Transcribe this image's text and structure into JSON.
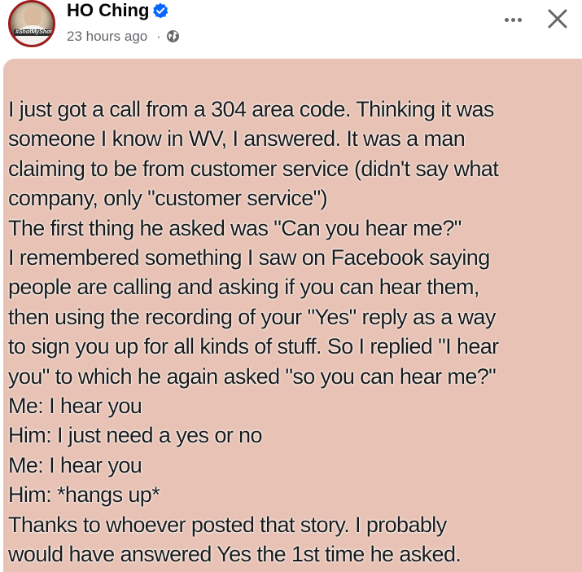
{
  "post": {
    "author": "HO Ching",
    "avatar_badge": "#ShotMyShot",
    "verified": true,
    "timestamp": "23 hours ago",
    "separator": "·",
    "audience_icon": "globe-icon",
    "actions": {
      "more_icon": "more-options-icon",
      "close_icon": "close-icon"
    },
    "background_color": "#e8c2b4",
    "text_lines": [
      "I just got a call from a 304 area code. Thinking it was",
      "someone I know in WV, I answered. It was a man",
      "claiming to be from customer service (didn't say what",
      "company, only \"customer service\")",
      "The first thing he asked was \"Can you hear me?\"",
      "I remembered something I saw on Facebook saying",
      "people are calling and asking if you can hear them,",
      "then using the recording of your \"Yes\" reply as a way",
      "to sign you up for all kinds of stuff. So I replied \"I hear",
      "you\" to which he again asked \"so you can hear me?\"",
      "Me: I hear you",
      "Him: I just need a yes or no",
      "Me: I hear you",
      "Him: *hangs up*",
      "Thanks to whoever posted that story. I probably",
      "would have answered Yes the 1st time he asked."
    ]
  }
}
